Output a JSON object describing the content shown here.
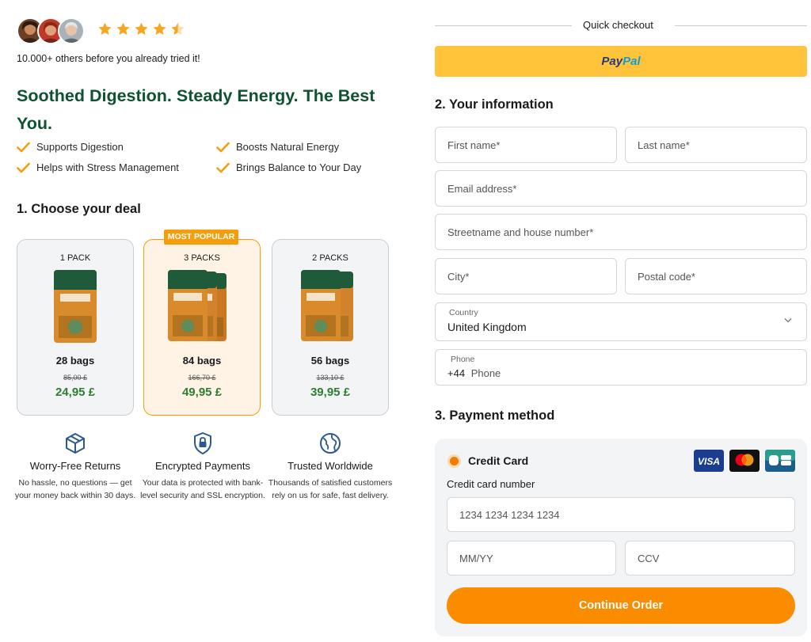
{
  "social_proof": {
    "rating": 4.5,
    "rating_max": 5,
    "tried_text": "10.000+ others before you already tried it!"
  },
  "headline": "Soothed Digestion. Steady Energy. The Best You.",
  "benefits": [
    "Supports Digestion",
    "Boosts Natural Energy",
    "Helps with Stress Management",
    "Brings Balance to Your Day"
  ],
  "deal_section": {
    "title": "1. Choose your deal",
    "badge": "MOST POPULAR",
    "deals": [
      {
        "title": "1 PACK",
        "bags": "28 bags",
        "old_price": "85,00 £",
        "price": "24,95 £"
      },
      {
        "title": "3 PACKS",
        "bags": "84 bags",
        "old_price": "166,70 £",
        "price": "49,95 £"
      },
      {
        "title": "2 PACKS",
        "bags": "56 bags",
        "old_price": "133,10 £",
        "price": "39,95 £"
      }
    ]
  },
  "features": [
    {
      "icon": "box-icon",
      "title": "Worry-Free Returns",
      "text": "No hassle, no questions — get your money back within 30 days."
    },
    {
      "icon": "lock-shield-icon",
      "title": "Encrypted Payments",
      "text": "Your data is protected with bank-level security and SSL encryption."
    },
    {
      "icon": "globe-icon",
      "title": "Trusted Worldwide",
      "text": "Thousands of satisfied customers rely on us for safe, fast delivery."
    }
  ],
  "checkout": {
    "quick_label": "Quick checkout",
    "paypal_part1": "Pay",
    "paypal_part2": "Pal"
  },
  "info_section": {
    "title": "2. Your information",
    "first_name": "First name*",
    "last_name": "Last name*",
    "email": "Email address*",
    "street": "Streetname and house number*",
    "city": "City*",
    "postal": "Postal code*",
    "country_label": "Country",
    "country_value": "United Kingdom",
    "phone_label": "Phone",
    "phone_prefix": "+44",
    "phone_placeholder": "Phone"
  },
  "payment_section": {
    "title": "3. Payment method",
    "method": "Credit Card",
    "cards": [
      "VISA",
      "Mastercard",
      "CB"
    ],
    "cc_number_label": "Credit card number",
    "cc_number_placeholder": "1234 1234 1234 1234",
    "expiry_placeholder": "MM/YY",
    "ccv_placeholder": "CCV",
    "continue_label": "Continue Order"
  },
  "colors": {
    "brand_green": "#0f5232",
    "price_green": "#2e7d32",
    "accent_orange": "#fb8c00",
    "paypal_yellow": "#ffc439",
    "star": "#f5a623"
  }
}
